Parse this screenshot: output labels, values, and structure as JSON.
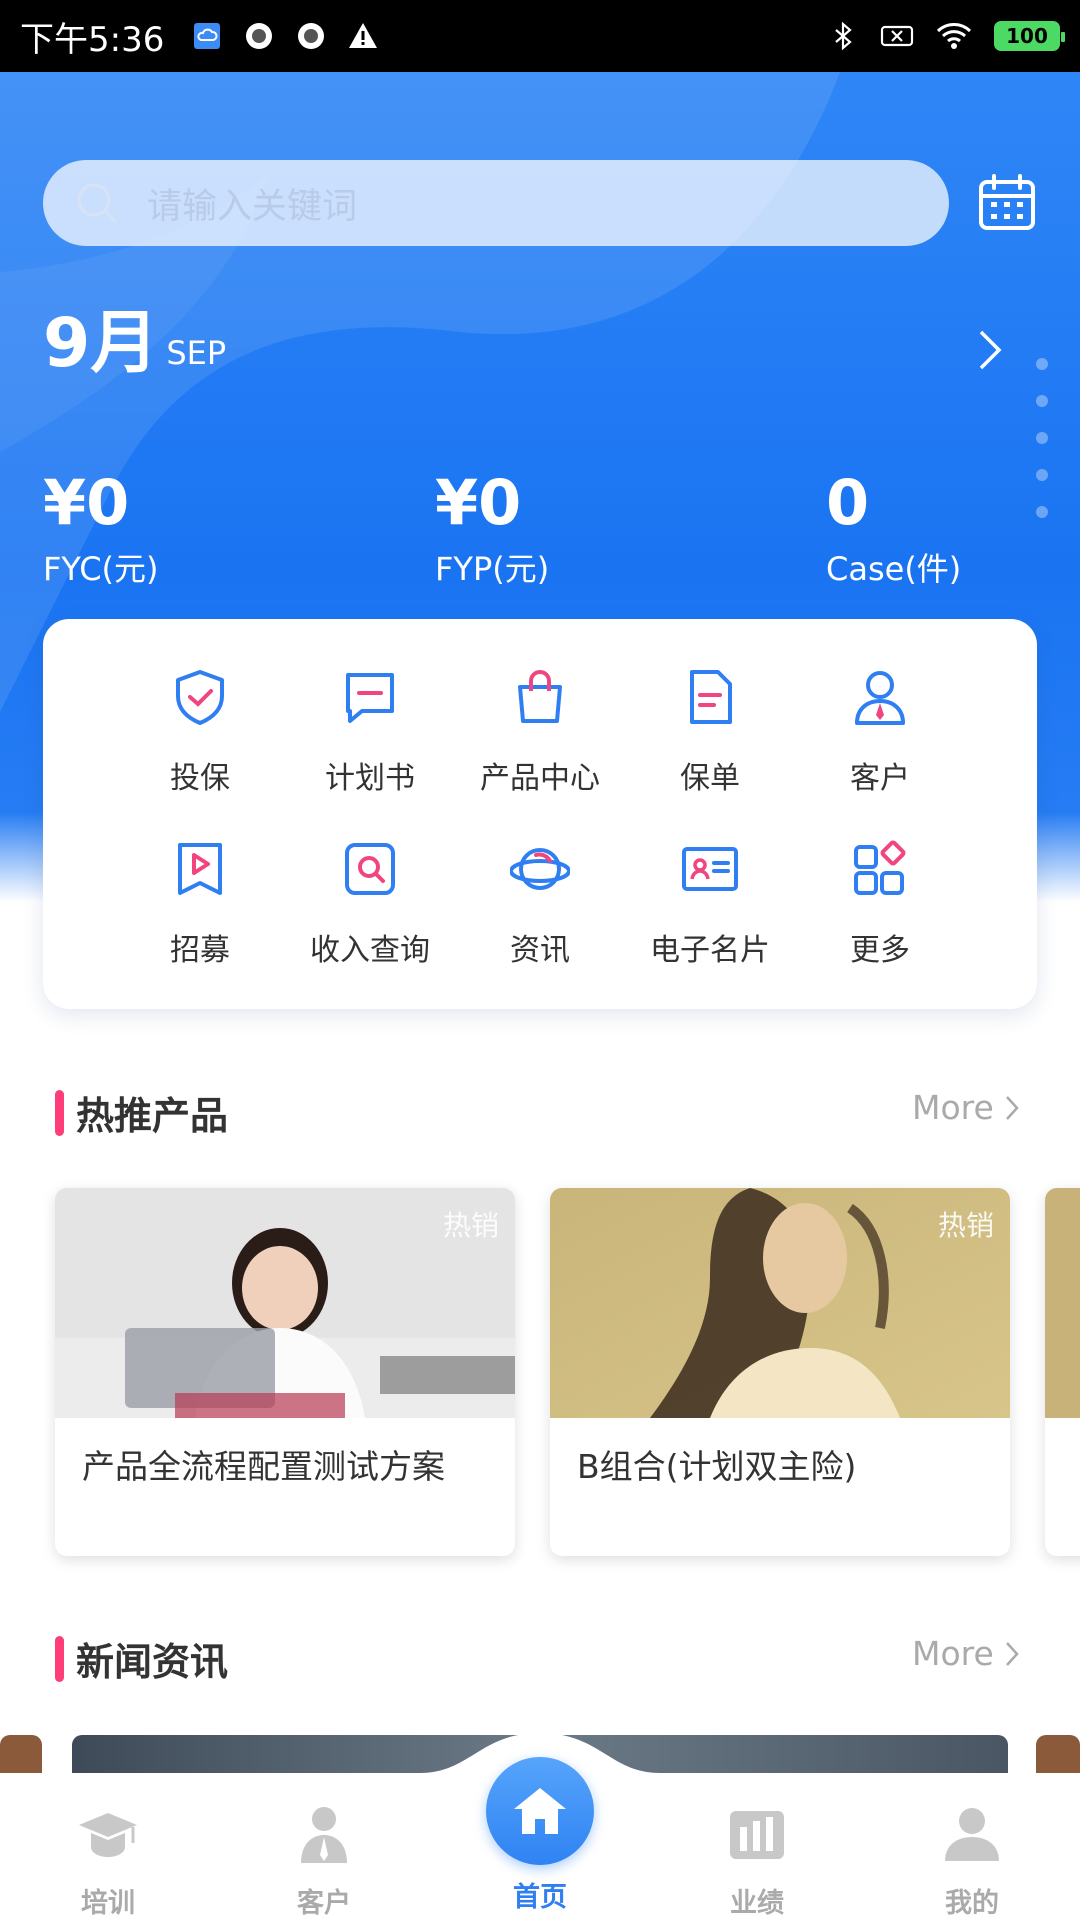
{
  "status_bar": {
    "time": "下午5:36",
    "battery": "100",
    "icons": [
      "cloud-app-icon",
      "record-icon",
      "record-icon",
      "warning-icon",
      "bluetooth-icon",
      "sim-off-icon",
      "wifi-icon",
      "battery-icon"
    ]
  },
  "search": {
    "placeholder": "请输入关键词"
  },
  "summary": {
    "month_number": "9月",
    "month_en": "SEP",
    "stats": [
      {
        "value": "¥0",
        "label": "FYC(元)"
      },
      {
        "value": "¥0",
        "label": "FYP(元)"
      },
      {
        "value": "0",
        "label": "Case(件)"
      }
    ]
  },
  "quick_menu": [
    {
      "label": "投保",
      "icon": "shield-check-icon"
    },
    {
      "label": "计划书",
      "icon": "chat-doc-icon"
    },
    {
      "label": "产品中心",
      "icon": "shopping-bag-icon"
    },
    {
      "label": "保单",
      "icon": "document-icon"
    },
    {
      "label": "客户",
      "icon": "person-icon"
    },
    {
      "label": "招募",
      "icon": "flag-play-icon"
    },
    {
      "label": "收入查询",
      "icon": "search-document-icon"
    },
    {
      "label": "资讯",
      "icon": "planet-icon"
    },
    {
      "label": "电子名片",
      "icon": "id-card-icon"
    },
    {
      "label": "更多",
      "icon": "grid-more-icon"
    }
  ],
  "hot_products": {
    "title": "热推产品",
    "more": "More",
    "items": [
      {
        "badge": "热销",
        "name": "产品全流程配置测试方案"
      },
      {
        "badge": "热销",
        "name": "B组合(计划双主险)"
      }
    ]
  },
  "news": {
    "title": "新闻资讯",
    "more": "More"
  },
  "tab_bar": [
    {
      "label": "培训",
      "icon": "graduation-cap-icon"
    },
    {
      "label": "客户",
      "icon": "customer-icon"
    },
    {
      "label": "首页",
      "icon": "home-icon",
      "active": true
    },
    {
      "label": "业绩",
      "icon": "bar-chart-icon"
    },
    {
      "label": "我的",
      "icon": "user-profile-icon"
    }
  ],
  "colors": {
    "brand_blue": "#1a74f2",
    "accent_pink": "#ff3e79",
    "icon_blue": "#2f7ff2",
    "icon_pink": "#f0457e"
  }
}
